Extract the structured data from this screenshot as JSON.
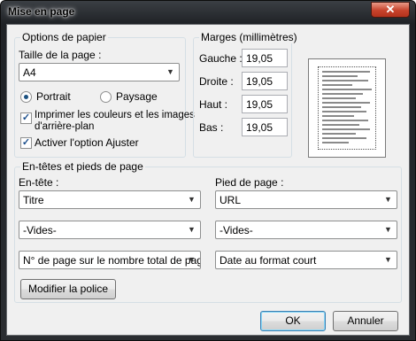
{
  "window": {
    "title": "Mise en page",
    "close_glyph": "✕"
  },
  "paper": {
    "group_label": "Options de papier",
    "size_label": "Taille de la page :",
    "size_value": "A4",
    "portrait_label": "Portrait",
    "landscape_label": "Paysage",
    "orientation": "portrait",
    "print_bg_label_line1": "Imprimer les couleurs et les images",
    "print_bg_label_line2": "d'arrière-plan",
    "print_bg_checked": true,
    "shrink_label": "Activer l'option Ajuster",
    "shrink_checked": true
  },
  "margins": {
    "group_label": "Marges (millimètres)",
    "left_label": "Gauche :",
    "left_value": "19,05",
    "right_label": "Droite :",
    "right_value": "19,05",
    "top_label": "Haut :",
    "top_value": "19,05",
    "bottom_label": "Bas :",
    "bottom_value": "19,05"
  },
  "headers": {
    "group_label": "En-têtes et pieds de page",
    "header_label": "En-tête :",
    "footer_label": "Pied de page :",
    "header_1": "Titre",
    "header_2": "-Vides-",
    "header_3": "N° de page sur le nombre total de pages",
    "footer_1": "URL",
    "footer_2": "-Vides-",
    "footer_3": "Date au format court",
    "font_button": "Modifier la police"
  },
  "buttons": {
    "ok": "OK",
    "cancel": "Annuler"
  },
  "icons": {
    "dropdown": "chevron-down-icon",
    "close": "close-icon",
    "pointer": "cursor-pointer-icon"
  }
}
